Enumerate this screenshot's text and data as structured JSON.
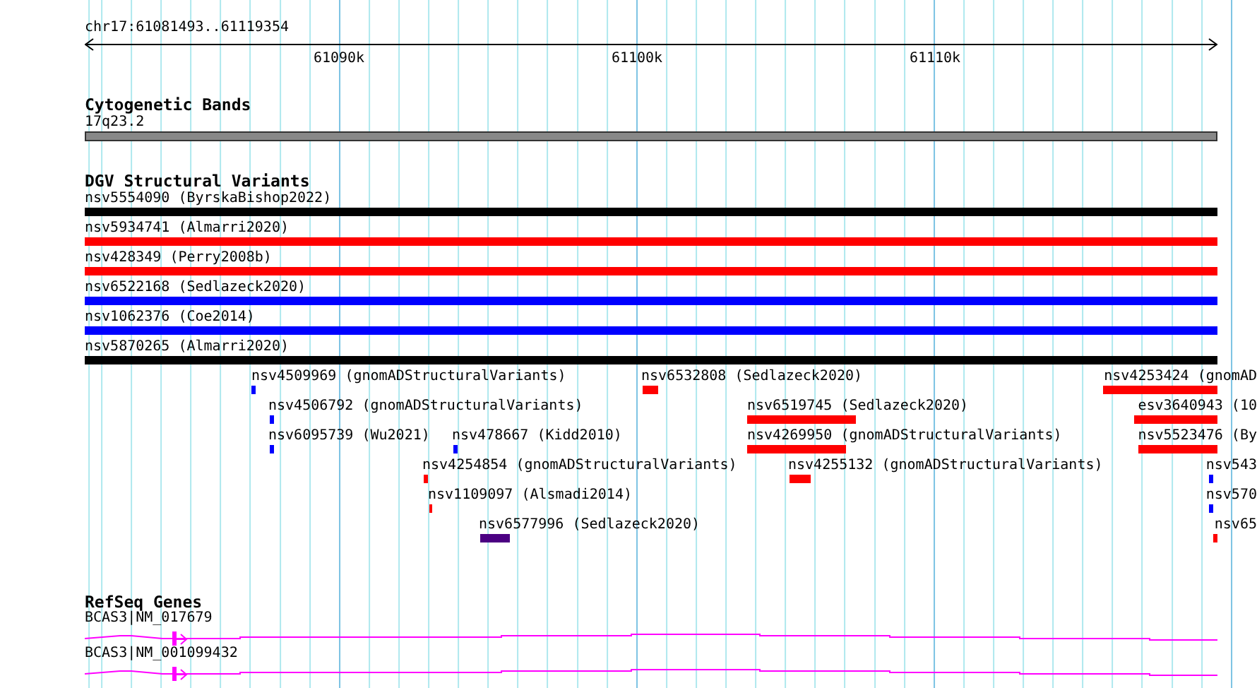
{
  "location": "chr17:61081493..61119354",
  "ruler": {
    "ticks": [
      "61090k",
      "61100k",
      "61110k"
    ]
  },
  "cytogenetic_bands": {
    "title": "Cytogenetic Bands",
    "bands": [
      {
        "label": "17q23.2"
      }
    ]
  },
  "dgv_structural_variants": {
    "title": "DGV Structural Variants",
    "spanning_variants": [
      {
        "label": "nsv5554090 (ByrskaBishop2022)",
        "color": "#000000"
      },
      {
        "label": "nsv5934741 (Almarri2020)",
        "color": "#ff0000"
      },
      {
        "label": "nsv428349 (Perry2008b)",
        "color": "#ff0000"
      },
      {
        "label": "nsv6522168 (Sedlazeck2020)",
        "color": "#0000ff"
      },
      {
        "label": "nsv1062376 (Coe2014)",
        "color": "#0000ff"
      },
      {
        "label": "nsv5870265 (Almarri2020)",
        "color": "#000000"
      }
    ],
    "local_variants": [
      {
        "label": "nsv4509969 (gnomADStructuralVariants)",
        "color": "#0000ff"
      },
      {
        "label": "nsv6532808 (Sedlazeck2020)",
        "color": "#ff0000"
      },
      {
        "label": "nsv4253424 (gnomAD",
        "color": "#ff0000"
      },
      {
        "label": "nsv4506792 (gnomADStructuralVariants)",
        "color": "#0000ff"
      },
      {
        "label": "nsv6519745 (Sedlazeck2020)",
        "color": "#ff0000"
      },
      {
        "label": "esv3640943 (10",
        "color": "#ff0000"
      },
      {
        "label": "nsv6095739 (Wu2021)",
        "color": "#0000ff"
      },
      {
        "label": "nsv478667 (Kidd2010)",
        "color": "#0000ff"
      },
      {
        "label": "nsv4269950 (gnomADStructuralVariants)",
        "color": "#ff0000"
      },
      {
        "label": "nsv5523476 (By",
        "color": "#ff0000"
      },
      {
        "label": "nsv4254854 (gnomADStructuralVariants)",
        "color": "#ff0000"
      },
      {
        "label": "nsv4255132 (gnomADStructuralVariants)",
        "color": "#ff0000"
      },
      {
        "label": "nsv543",
        "color": "#0000ff"
      },
      {
        "label": "nsv1109097 (Alsmadi2014)",
        "color": "#ff0000"
      },
      {
        "label": "nsv570",
        "color": "#0000ff"
      },
      {
        "label": "nsv6577996 (Sedlazeck2020)",
        "color": "#4b0082"
      },
      {
        "label": "nsv65",
        "color": "#ff0000"
      }
    ]
  },
  "refseq_genes": {
    "title": "RefSeq Genes",
    "genes": [
      {
        "label": "BCAS3|NM_017679"
      },
      {
        "label": "BCAS3|NM_001099432"
      }
    ]
  }
}
